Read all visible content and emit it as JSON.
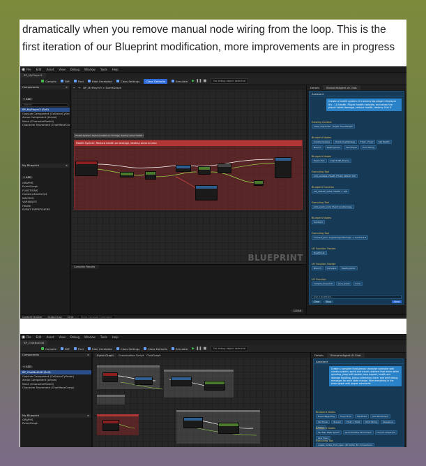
{
  "caption": {
    "line1": "dramatically when you remove manual node wiring from the loop. This is the",
    "line2": "first iteration of our Blueprint modification, more improvements are in progress"
  },
  "shot1": {
    "menus": [
      "File",
      "Edit",
      "Asset",
      "View",
      "Debug",
      "Window",
      "Tools",
      "Help"
    ],
    "tabs": [
      "BP_MyPlayer3"
    ],
    "toolbar": [
      "Compile",
      "Diff",
      "Find",
      "Hide Unrelated",
      "Class Settings",
      "Class Defaults",
      "Simulate"
    ],
    "debug_filter": "No debug object selected",
    "components_title": "Components",
    "add_label": "+ ADD",
    "search_placeholder": "Search",
    "components": [
      {
        "name": "BP_MyPlayer3 (Self)",
        "sel": true
      },
      {
        "name": "Capsule Component (CollisionCylinder)",
        "sel": false
      },
      {
        "name": "Arrow Component (Arrow)",
        "sel": false
      },
      {
        "name": "Mesh (CharacterMesh0)",
        "sel": false
      },
      {
        "name": "Character Movement (CharMoveComp)",
        "sel": false
      }
    ],
    "mybp_title": "My Blueprint",
    "mybp_rows": [
      "GRAPHS",
      "EventGraph",
      "FUNCTIONS",
      "ConstructionScript",
      "MACROS",
      "VARIABLES",
      "Health",
      "EVENT DISPATCHERS"
    ],
    "health_type": "Float",
    "graph_tabs": [
      "Event Graph"
    ],
    "breadcrumb": "BP_MyPlayer3 > EventGraph",
    "comment_small": "Health System: Reduce health on damage, destroy when health reaches zero",
    "comment_big": "Health System: Reduce health on damage, destroy actor at zero",
    "watermark": "BLUEPRINT",
    "compiler_tab": "Compiler Results",
    "clear_label": "CLEAR",
    "details_tab": "Details",
    "assistant_tab": "BlueprintAgent AI Chat",
    "chat_title": "Assistant",
    "user_message": "Create a health system: if a enemy bp player hit player it's - 10 health. Player health variable, and when the player takes damage, reduce health, destroy it at 0",
    "groups": [
      {
        "title": "Existing Context",
        "items": [
          "class: Character · Graph: EventGraph"
        ]
      },
      {
        "title": "Blueprint Nodes",
        "items": [
          "Create Variable",
          "Event AnyDamage",
          "Float - Float",
          "Set Health",
          "Branch",
          "DestroyActor",
          "Less Equal",
          "Print String"
        ]
      },
      {
        "title": "Blueprint Nodes",
        "items": [
          "Event Tick",
          "Cast To BP_Enemy"
        ]
      },
      {
        "title": "Executing Tool",
        "items": [
          "add_variable: Health (Float) default 100"
        ]
      },
      {
        "title": "Blueprint Function",
        "items": [
          "set_default_value: Health = 100"
        ]
      },
      {
        "title": "Executing Tool",
        "items": [
          "add_event_node: Event AnyDamage"
        ]
      },
      {
        "title": "Blueprint Nodes",
        "items": [
          "Subtract"
        ]
      },
      {
        "title": "Executing Tool",
        "items": [
          "connect_pins: AnyDamage.Damage -> Subtract.B"
        ]
      },
      {
        "title": "UE Function Tracker",
        "items": [
          "Health Set"
        ]
      },
      {
        "title": "UE Function Tracker",
        "items": [
          "Branch",
          "Compare",
          "DestroyActor"
        ]
      },
      {
        "title": "UE Function",
        "items": [
          "compile_blueprint",
          "save_asset",
          "done"
        ]
      }
    ],
    "chat_placeholder": "Ask a question...",
    "footer_buttons": [
      "Clear",
      "Stop",
      "Send"
    ],
    "status": [
      "Content Drawer",
      "Output Log",
      "Cmd",
      "Enter Console Command"
    ]
  },
  "shot2": {
    "menus": [
      "File",
      "Edit",
      "Asset",
      "View",
      "Debug",
      "Window",
      "Tools",
      "Help"
    ],
    "tabs": [
      "BP_ChatBot046"
    ],
    "toolbar": [
      "Compile",
      "Diff",
      "Find",
      "Hide Unrelated",
      "Class Settings",
      "Class Defaults",
      "Simulate"
    ],
    "debug_filter": "No debug object selected",
    "components_title": "Components",
    "components": [
      {
        "name": "BP_ChatBot046 (Self)",
        "sel": true
      },
      {
        "name": "Capsule Component (CollisionCylinder)",
        "sel": false
      },
      {
        "name": "Arrow Component (Arrow)",
        "sel": false
      },
      {
        "name": "Mesh (CharacterMesh0)",
        "sel": false
      },
      {
        "name": "Character Movement (CharMoveComp)",
        "sel": false
      }
    ],
    "mybp_title": "My Blueprint",
    "mybp_rows": [
      "GRAPHS",
      "EventGraph"
    ],
    "graph_tabs": [
      "Event Graph",
      "Construction Script",
      "ChatGraph"
    ],
    "details_tab": "Details",
    "assistant_tab": "BlueprintAgent AI Chat",
    "chat_title": "Assistant",
    "user_message": "Create a complete third-person character controller with camera system, sprint and crouch, stamina that drains while sprinting, jump with double jump support, health and damage handling, pickup interaction trace, and print debug messages for each state change. Wire everything in the event graph with proper comments.",
    "groups": [
      {
        "title": "Blueprint Nodes",
        "items": [
          "Event BeginPlay",
          "Event Tick",
          "InputAxis",
          "Add Movement",
          "Set Timer",
          "Branch",
          "Float > Float",
          "Print String",
          "Sequence",
          "Delay"
        ]
      },
      {
        "title": "Blueprint Nodes",
        "items": [
          "Set Max Walk Speed",
          "Get Character Movement",
          "Launch Character",
          "Line Trace"
        ]
      },
      {
        "title": "Executing Tool",
        "items": [
          "create_nodes_from_spec: 48 nodes, 61 connections"
        ]
      }
    ]
  }
}
